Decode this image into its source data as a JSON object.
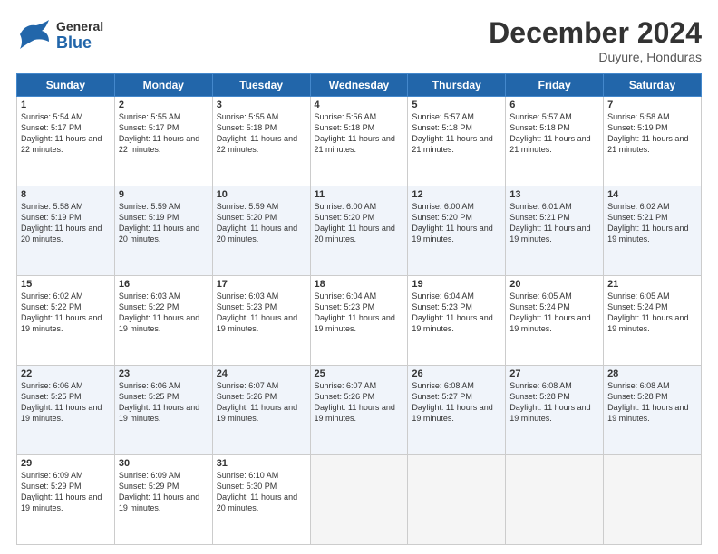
{
  "header": {
    "logo_general": "General",
    "logo_blue": "Blue",
    "month_title": "December 2024",
    "location": "Duyure, Honduras"
  },
  "calendar": {
    "headers": [
      "Sunday",
      "Monday",
      "Tuesday",
      "Wednesday",
      "Thursday",
      "Friday",
      "Saturday"
    ],
    "weeks": [
      [
        {
          "day": "",
          "empty": true
        },
        {
          "day": "",
          "empty": true
        },
        {
          "day": "",
          "empty": true
        },
        {
          "day": "",
          "empty": true
        },
        {
          "day": "",
          "empty": true
        },
        {
          "day": "",
          "empty": true
        },
        {
          "day": "",
          "empty": true
        }
      ],
      [
        {
          "day": "1",
          "sunrise": "5:54 AM",
          "sunset": "5:17 PM",
          "daylight": "11 hours and 22 minutes."
        },
        {
          "day": "2",
          "sunrise": "5:55 AM",
          "sunset": "5:17 PM",
          "daylight": "11 hours and 22 minutes."
        },
        {
          "day": "3",
          "sunrise": "5:55 AM",
          "sunset": "5:18 PM",
          "daylight": "11 hours and 22 minutes."
        },
        {
          "day": "4",
          "sunrise": "5:56 AM",
          "sunset": "5:18 PM",
          "daylight": "11 hours and 21 minutes."
        },
        {
          "day": "5",
          "sunrise": "5:57 AM",
          "sunset": "5:18 PM",
          "daylight": "11 hours and 21 minutes."
        },
        {
          "day": "6",
          "sunrise": "5:57 AM",
          "sunset": "5:18 PM",
          "daylight": "11 hours and 21 minutes."
        },
        {
          "day": "7",
          "sunrise": "5:58 AM",
          "sunset": "5:19 PM",
          "daylight": "11 hours and 21 minutes."
        }
      ],
      [
        {
          "day": "8",
          "sunrise": "5:58 AM",
          "sunset": "5:19 PM",
          "daylight": "11 hours and 20 minutes."
        },
        {
          "day": "9",
          "sunrise": "5:59 AM",
          "sunset": "5:19 PM",
          "daylight": "11 hours and 20 minutes."
        },
        {
          "day": "10",
          "sunrise": "5:59 AM",
          "sunset": "5:20 PM",
          "daylight": "11 hours and 20 minutes."
        },
        {
          "day": "11",
          "sunrise": "6:00 AM",
          "sunset": "5:20 PM",
          "daylight": "11 hours and 20 minutes."
        },
        {
          "day": "12",
          "sunrise": "6:00 AM",
          "sunset": "5:20 PM",
          "daylight": "11 hours and 19 minutes."
        },
        {
          "day": "13",
          "sunrise": "6:01 AM",
          "sunset": "5:21 PM",
          "daylight": "11 hours and 19 minutes."
        },
        {
          "day": "14",
          "sunrise": "6:02 AM",
          "sunset": "5:21 PM",
          "daylight": "11 hours and 19 minutes."
        }
      ],
      [
        {
          "day": "15",
          "sunrise": "6:02 AM",
          "sunset": "5:22 PM",
          "daylight": "11 hours and 19 minutes."
        },
        {
          "day": "16",
          "sunrise": "6:03 AM",
          "sunset": "5:22 PM",
          "daylight": "11 hours and 19 minutes."
        },
        {
          "day": "17",
          "sunrise": "6:03 AM",
          "sunset": "5:23 PM",
          "daylight": "11 hours and 19 minutes."
        },
        {
          "day": "18",
          "sunrise": "6:04 AM",
          "sunset": "5:23 PM",
          "daylight": "11 hours and 19 minutes."
        },
        {
          "day": "19",
          "sunrise": "6:04 AM",
          "sunset": "5:23 PM",
          "daylight": "11 hours and 19 minutes."
        },
        {
          "day": "20",
          "sunrise": "6:05 AM",
          "sunset": "5:24 PM",
          "daylight": "11 hours and 19 minutes."
        },
        {
          "day": "21",
          "sunrise": "6:05 AM",
          "sunset": "5:24 PM",
          "daylight": "11 hours and 19 minutes."
        }
      ],
      [
        {
          "day": "22",
          "sunrise": "6:06 AM",
          "sunset": "5:25 PM",
          "daylight": "11 hours and 19 minutes."
        },
        {
          "day": "23",
          "sunrise": "6:06 AM",
          "sunset": "5:25 PM",
          "daylight": "11 hours and 19 minutes."
        },
        {
          "day": "24",
          "sunrise": "6:07 AM",
          "sunset": "5:26 PM",
          "daylight": "11 hours and 19 minutes."
        },
        {
          "day": "25",
          "sunrise": "6:07 AM",
          "sunset": "5:26 PM",
          "daylight": "11 hours and 19 minutes."
        },
        {
          "day": "26",
          "sunrise": "6:08 AM",
          "sunset": "5:27 PM",
          "daylight": "11 hours and 19 minutes."
        },
        {
          "day": "27",
          "sunrise": "6:08 AM",
          "sunset": "5:28 PM",
          "daylight": "11 hours and 19 minutes."
        },
        {
          "day": "28",
          "sunrise": "6:08 AM",
          "sunset": "5:28 PM",
          "daylight": "11 hours and 19 minutes."
        }
      ],
      [
        {
          "day": "29",
          "sunrise": "6:09 AM",
          "sunset": "5:29 PM",
          "daylight": "11 hours and 19 minutes."
        },
        {
          "day": "30",
          "sunrise": "6:09 AM",
          "sunset": "5:29 PM",
          "daylight": "11 hours and 19 minutes."
        },
        {
          "day": "31",
          "sunrise": "6:10 AM",
          "sunset": "5:30 PM",
          "daylight": "11 hours and 20 minutes."
        },
        {
          "day": "",
          "empty": true
        },
        {
          "day": "",
          "empty": true
        },
        {
          "day": "",
          "empty": true
        },
        {
          "day": "",
          "empty": true
        }
      ]
    ]
  }
}
